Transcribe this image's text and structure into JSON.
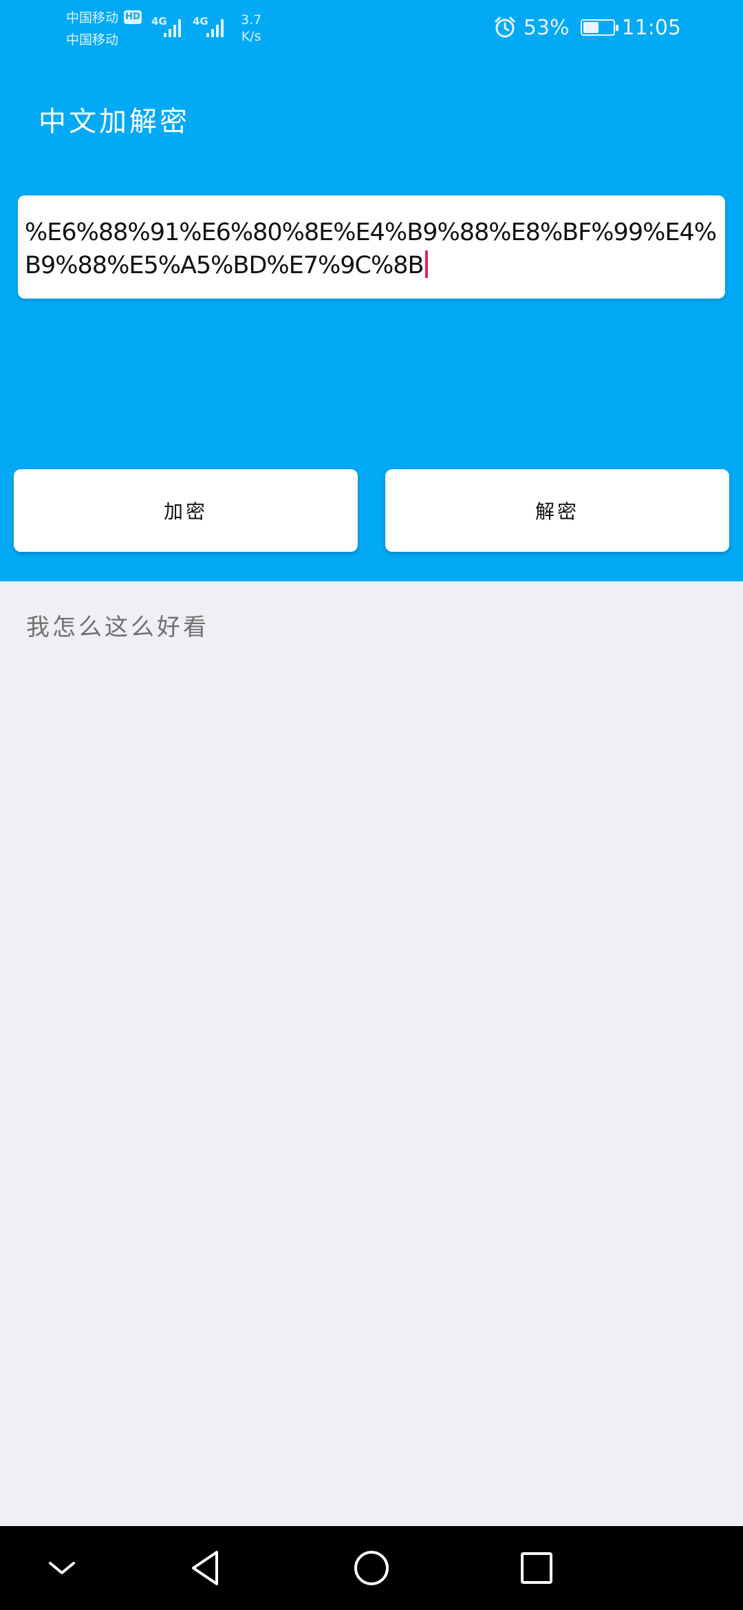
{
  "status_bar": {
    "carrier_1": "中国移动",
    "carrier_2": "中国移动",
    "hd_badge": "HD",
    "network_1": "4G",
    "network_2": "4G",
    "speed_value": "3.7",
    "speed_unit": "K/s",
    "battery_percent": "53%",
    "battery_level": 0.53,
    "time": "11:05",
    "icons": [
      "alarm-icon",
      "signal-icon",
      "battery-icon"
    ]
  },
  "app": {
    "title": "中文加解密"
  },
  "input": {
    "value": "%E6%88%91%E6%80%8E%E4%B9%88%E8%BF%99%E4%B9%88%E5%A5%BD%E7%9C%8B"
  },
  "buttons": {
    "encrypt_label": "加密",
    "decrypt_label": "解密"
  },
  "result": {
    "text": "我怎么这么好看"
  },
  "nav_bar": {
    "icons": [
      "chevron-down-icon",
      "back-triangle-icon",
      "home-circle-icon",
      "recent-square-icon"
    ]
  },
  "colors": {
    "primary": "#03a9f4",
    "background": "#efeff4",
    "caret": "#e91e63",
    "result_text": "#707070"
  }
}
